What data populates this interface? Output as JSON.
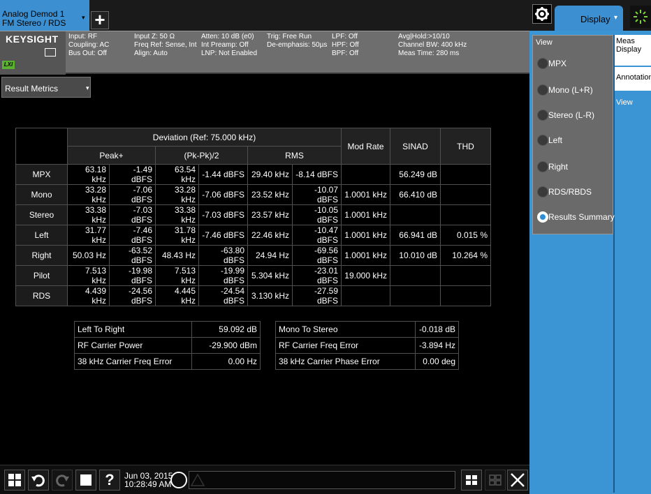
{
  "topbar": {
    "mode_line1": "Analog Demod 1",
    "mode_line2": "FM Stereo / RDS",
    "mode_dropdown_glyph": "▾",
    "add_button_glyph": "+",
    "display_tab": "Display",
    "display_dropdown_glyph": "▾",
    "icons": [
      "settings-gear-icon",
      "busy-indicator-icon"
    ]
  },
  "settings": {
    "brand": "KEYSIGHT",
    "lxi": "LXI",
    "groups": [
      [
        "Input: RF",
        "Coupling: AC",
        "Bus Out: Off"
      ],
      [
        "Input Z: 50 Ω",
        "Freq Ref: Sense, Int",
        "Align: Auto"
      ],
      [
        "Atten: 10 dB (e0)",
        "Int Preamp: Off",
        "LNP: Not Enabled"
      ],
      [
        "Trig: Free Run",
        "De-emphasis: 50µs"
      ],
      [
        "LPF: Off",
        "HPF: Off",
        "BPF: Off"
      ],
      [
        "Avg|Hold:>10/10",
        "Channel BW: 400 kHz",
        "Meas Time: 280 ms"
      ]
    ]
  },
  "window": {
    "selector_label": "Result Metrics",
    "selector_glyph": "▾"
  },
  "table": {
    "deviation_header": "Deviation (Ref: 75.000 kHz)",
    "sub_headers": [
      "Peak+",
      "(Pk-Pk)/2",
      "RMS"
    ],
    "other_headers": [
      "Mod Rate",
      "SINAD",
      "THD"
    ],
    "rows": [
      {
        "name": "MPX",
        "cells": [
          "63.18 kHz",
          "-1.49 dBFS",
          "63.54 kHz",
          "-1.44 dBFS",
          "29.40 kHz",
          "-8.14 dBFS",
          "",
          "56.249 dB",
          ""
        ]
      },
      {
        "name": "Mono",
        "cells": [
          "33.28 kHz",
          "-7.06 dBFS",
          "33.28 kHz",
          "-7.06 dBFS",
          "23.52 kHz",
          "-10.07 dBFS",
          "1.0001 kHz",
          "66.410 dB",
          ""
        ]
      },
      {
        "name": "Stereo",
        "cells": [
          "33.38 kHz",
          "-7.03 dBFS",
          "33.38 kHz",
          "-7.03 dBFS",
          "23.57 kHz",
          "-10.05 dBFS",
          "1.0001 kHz",
          "",
          ""
        ]
      },
      {
        "name": "Left",
        "cells": [
          "31.77 kHz",
          "-7.46 dBFS",
          "31.78 kHz",
          "-7.46 dBFS",
          "22.46 kHz",
          "-10.47 dBFS",
          "1.0001 kHz",
          "66.941 dB",
          "0.015 %"
        ]
      },
      {
        "name": "Right",
        "cells": [
          "50.03 Hz",
          "-63.52 dBFS",
          "48.43 Hz",
          "-63.80 dBFS",
          "24.94 Hz",
          "-69.56 dBFS",
          "1.0001 kHz",
          "10.010 dB",
          "10.264 %"
        ]
      },
      {
        "name": "Pilot",
        "cells": [
          "7.513 kHz",
          "-19.98 dBFS",
          "7.513 kHz",
          "-19.99 dBFS",
          "5.304 kHz",
          "-23.01 dBFS",
          "19.000 kHz",
          "",
          ""
        ]
      },
      {
        "name": "RDS",
        "cells": [
          "4.439 kHz",
          "-24.56 dBFS",
          "4.445 kHz",
          "-24.54 dBFS",
          "3.130 kHz",
          "-27.59 dBFS",
          "",
          "",
          ""
        ]
      }
    ]
  },
  "summary_left": [
    {
      "label": "Left To Right",
      "value": "59.092 dB"
    },
    {
      "label": "RF Carrier Power",
      "value": "-29.900 dBm"
    },
    {
      "label": "38 kHz Carrier Freq Error",
      "value": "0.00 Hz"
    }
  ],
  "summary_right": [
    {
      "label": "Mono To Stereo",
      "value": "-0.018 dB"
    },
    {
      "label": "RF Carrier Freq Error",
      "value": "-3.894 Hz"
    },
    {
      "label": "38 kHz Carrier Phase Error",
      "value": "0.00 deg"
    }
  ],
  "bottombar": {
    "date": "Jun 03, 2015",
    "time": "10:28:49 AM",
    "help_glyph": "?",
    "icons": [
      "windows-start-icon",
      "undo-icon",
      "redo-icon",
      "file-icon",
      "help-icon",
      "message-icon",
      "warning-icon",
      "multi-window-icon",
      "single-window-icon",
      "maximize-icon"
    ]
  },
  "view_menu": {
    "title": "View",
    "options": [
      "MPX",
      "Mono (L+R)",
      "Stereo (L-R)",
      "Left",
      "Right",
      "RDS/RBDS",
      "Results Summary"
    ],
    "selected": "Results Summary"
  },
  "right_tabs": {
    "meas_display_1": "Meas",
    "meas_display_2": "Display",
    "annotation": "Annotation",
    "view": "View"
  },
  "colors": {
    "accent_blue": "#3b94d4",
    "panel_grey": "#6e6e6e",
    "lxi_green": "#5ab030"
  }
}
